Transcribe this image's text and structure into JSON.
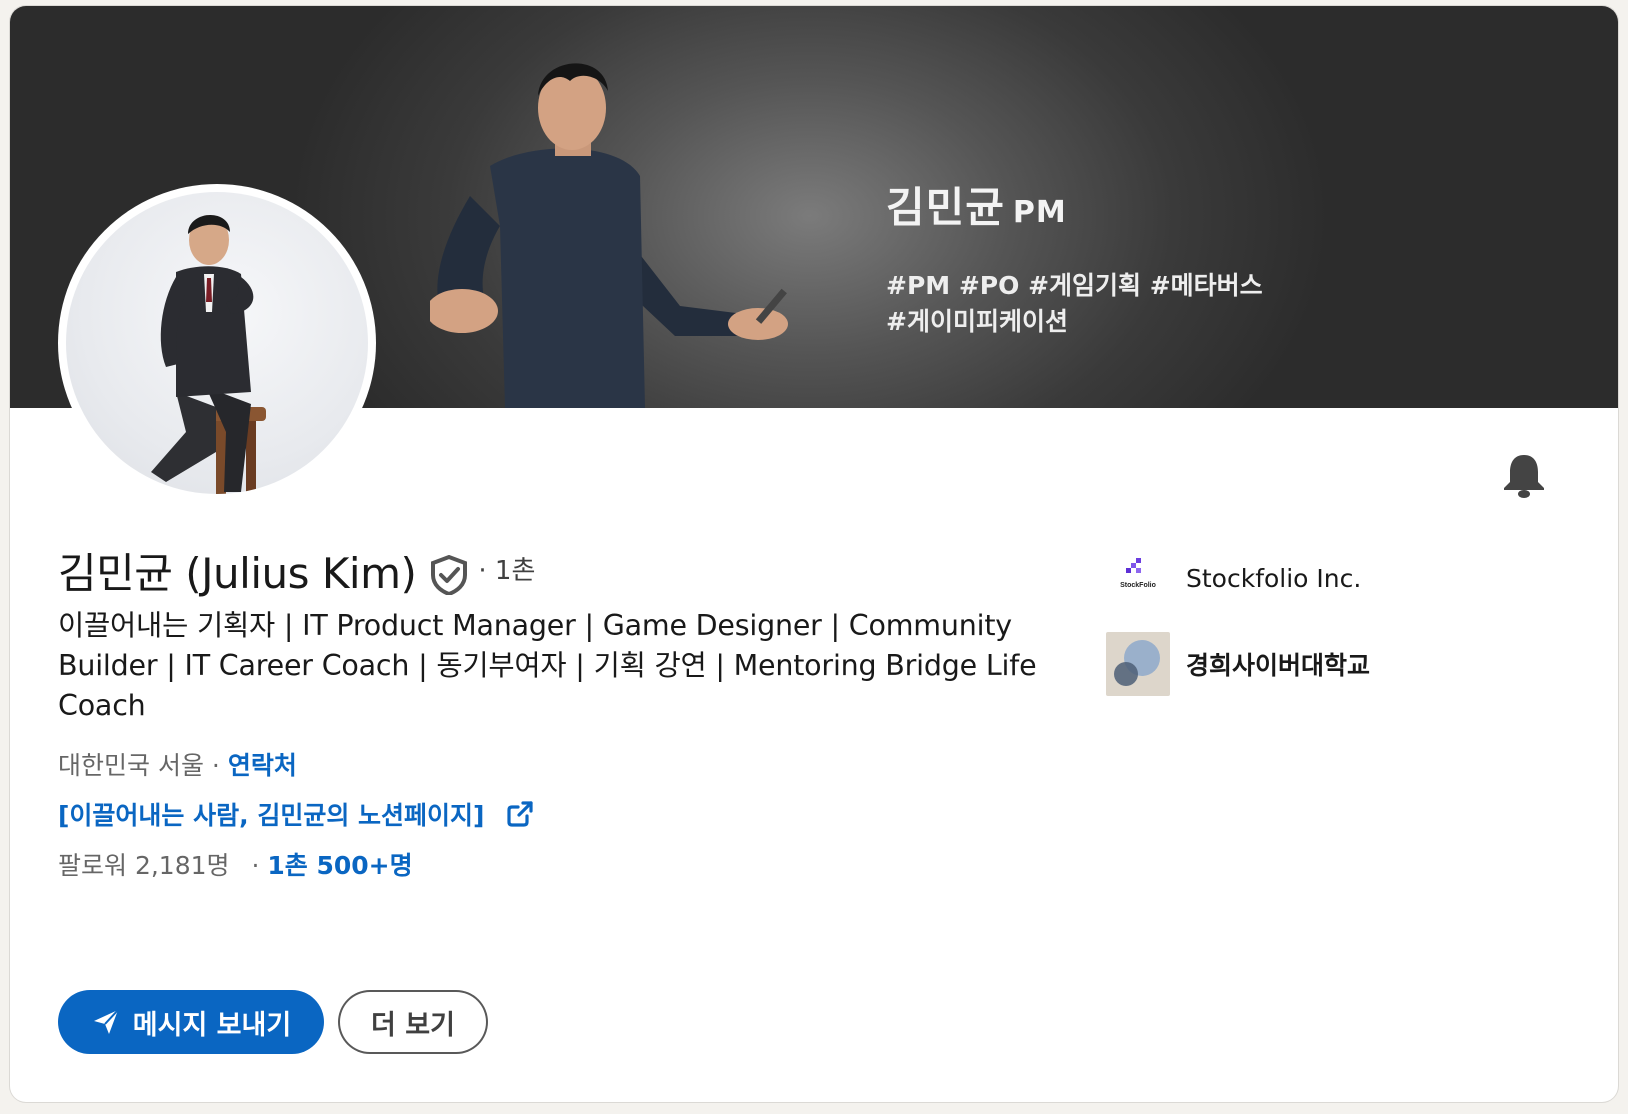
{
  "banner": {
    "name": "김민균",
    "role": "PM",
    "tags_line1": "#PM #PO #게임기획 #메타버스",
    "tags_line2": "#게이미피케이션"
  },
  "profile": {
    "full_name": "김민균 (Julius Kim)",
    "degree": "· 1촌",
    "headline": "이끌어내는 기획자 | IT Product Manager | Game Designer | Community Builder | IT Career Coach | 동기부여자 | 기획 강연 | Mentoring Bridge Life Coach",
    "location": "대한민국 서울",
    "separator": "·",
    "contact_label": "연락처",
    "notion_link": "[이끌어내는 사람, 김민균의 노션페이지]",
    "followers": "팔로워 2,181명",
    "connections": "1촌 500+명"
  },
  "organizations": [
    {
      "name": "Stockfolio Inc.",
      "logo_text": "StockFolio",
      "icon": "stockfolio-logo"
    },
    {
      "name": "경희사이버대학교",
      "icon": "university-logo"
    }
  ],
  "actions": {
    "message_label": "메시지 보내기",
    "more_label": "더 보기"
  },
  "icons": {
    "notification": "bell-icon",
    "verified": "shield-check-icon",
    "external": "external-link-icon",
    "send": "paper-plane-icon"
  },
  "colors": {
    "accent": "#0a66c2",
    "background": "#f4f2ee",
    "card": "#ffffff"
  }
}
